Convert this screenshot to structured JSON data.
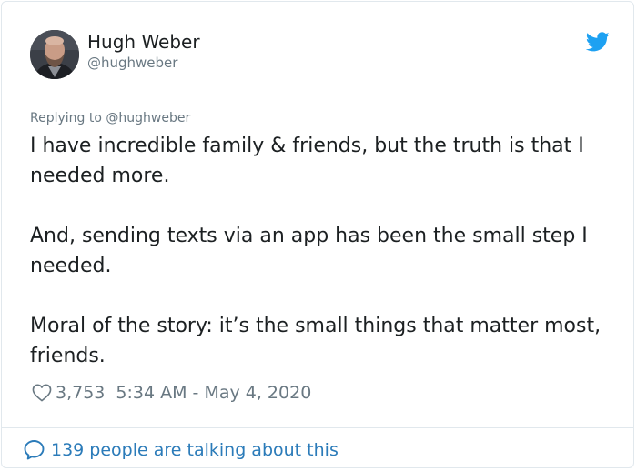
{
  "author": {
    "name": "Hugh Weber",
    "handle": "@hughweber"
  },
  "tweet": {
    "replying_to": "Replying to @hughweber",
    "paragraphs": [
      "I have incredible family & friends, but the truth is that I needed more.",
      "And, sending texts via an app has been the small step I needed.",
      "Moral of the story: it’s the small things that matter most, friends."
    ],
    "like_count": "3,753",
    "timestamp": "5:34 AM - May 4, 2020"
  },
  "footer": {
    "talking_label": "139 people are talking about this"
  },
  "icons": {
    "logo": "twitter-bird-icon",
    "like": "heart-icon",
    "reply": "speech-bubble-icon"
  },
  "colors": {
    "brand_blue": "#1da1f2",
    "link_blue": "#2b7bb9",
    "muted_text": "#697882",
    "text": "#1c2022",
    "border": "#e1e8ed"
  }
}
